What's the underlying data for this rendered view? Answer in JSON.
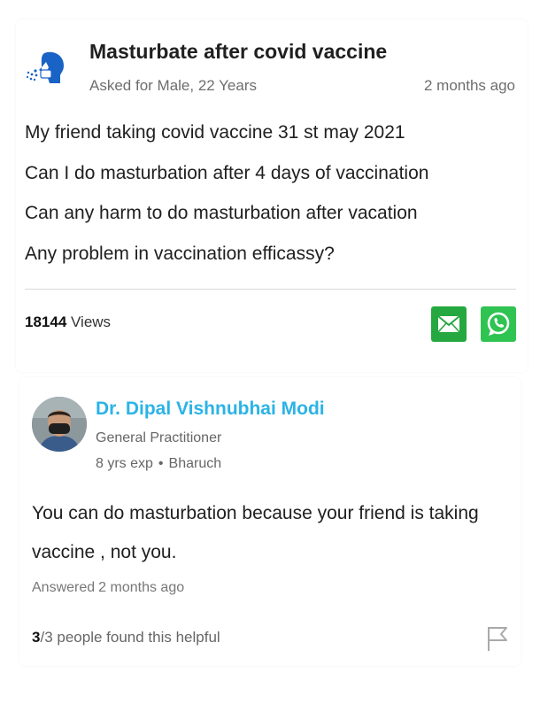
{
  "question": {
    "title": "Masturbate after covid vaccine",
    "asked_for": "Asked for Male, 22 Years",
    "time": "2 months ago",
    "lines": [
      "My friend taking covid vaccine 31 st may 2021",
      "Can I do masturbation after 4 days of vaccination",
      "Can any harm to do masturbation after vacation",
      "Any problem in vaccination efficassy?"
    ],
    "views_count": "18144",
    "views_label": "Views",
    "icon": "patient-sneeze-icon"
  },
  "share": {
    "mail_icon": "mail-icon",
    "whatsapp_icon": "whatsapp-icon",
    "mail_color": "#25a840",
    "whatsapp_color": "#2fc352"
  },
  "answer": {
    "doctor_name": "Dr. Dipal Vishnubhai Modi",
    "specialty": "General Practitioner",
    "experience": "8 yrs exp",
    "separator": "•",
    "location": "Bharuch",
    "text": "You can do masturbation because your friend is taking vaccine , not you.",
    "answered_label": "Answered",
    "answered_time": "2 months ago",
    "helpful_count": "3",
    "helpful_rest": "/3 people found this helpful",
    "name_color": "#2bb3e6",
    "flag_icon": "flag-icon"
  }
}
